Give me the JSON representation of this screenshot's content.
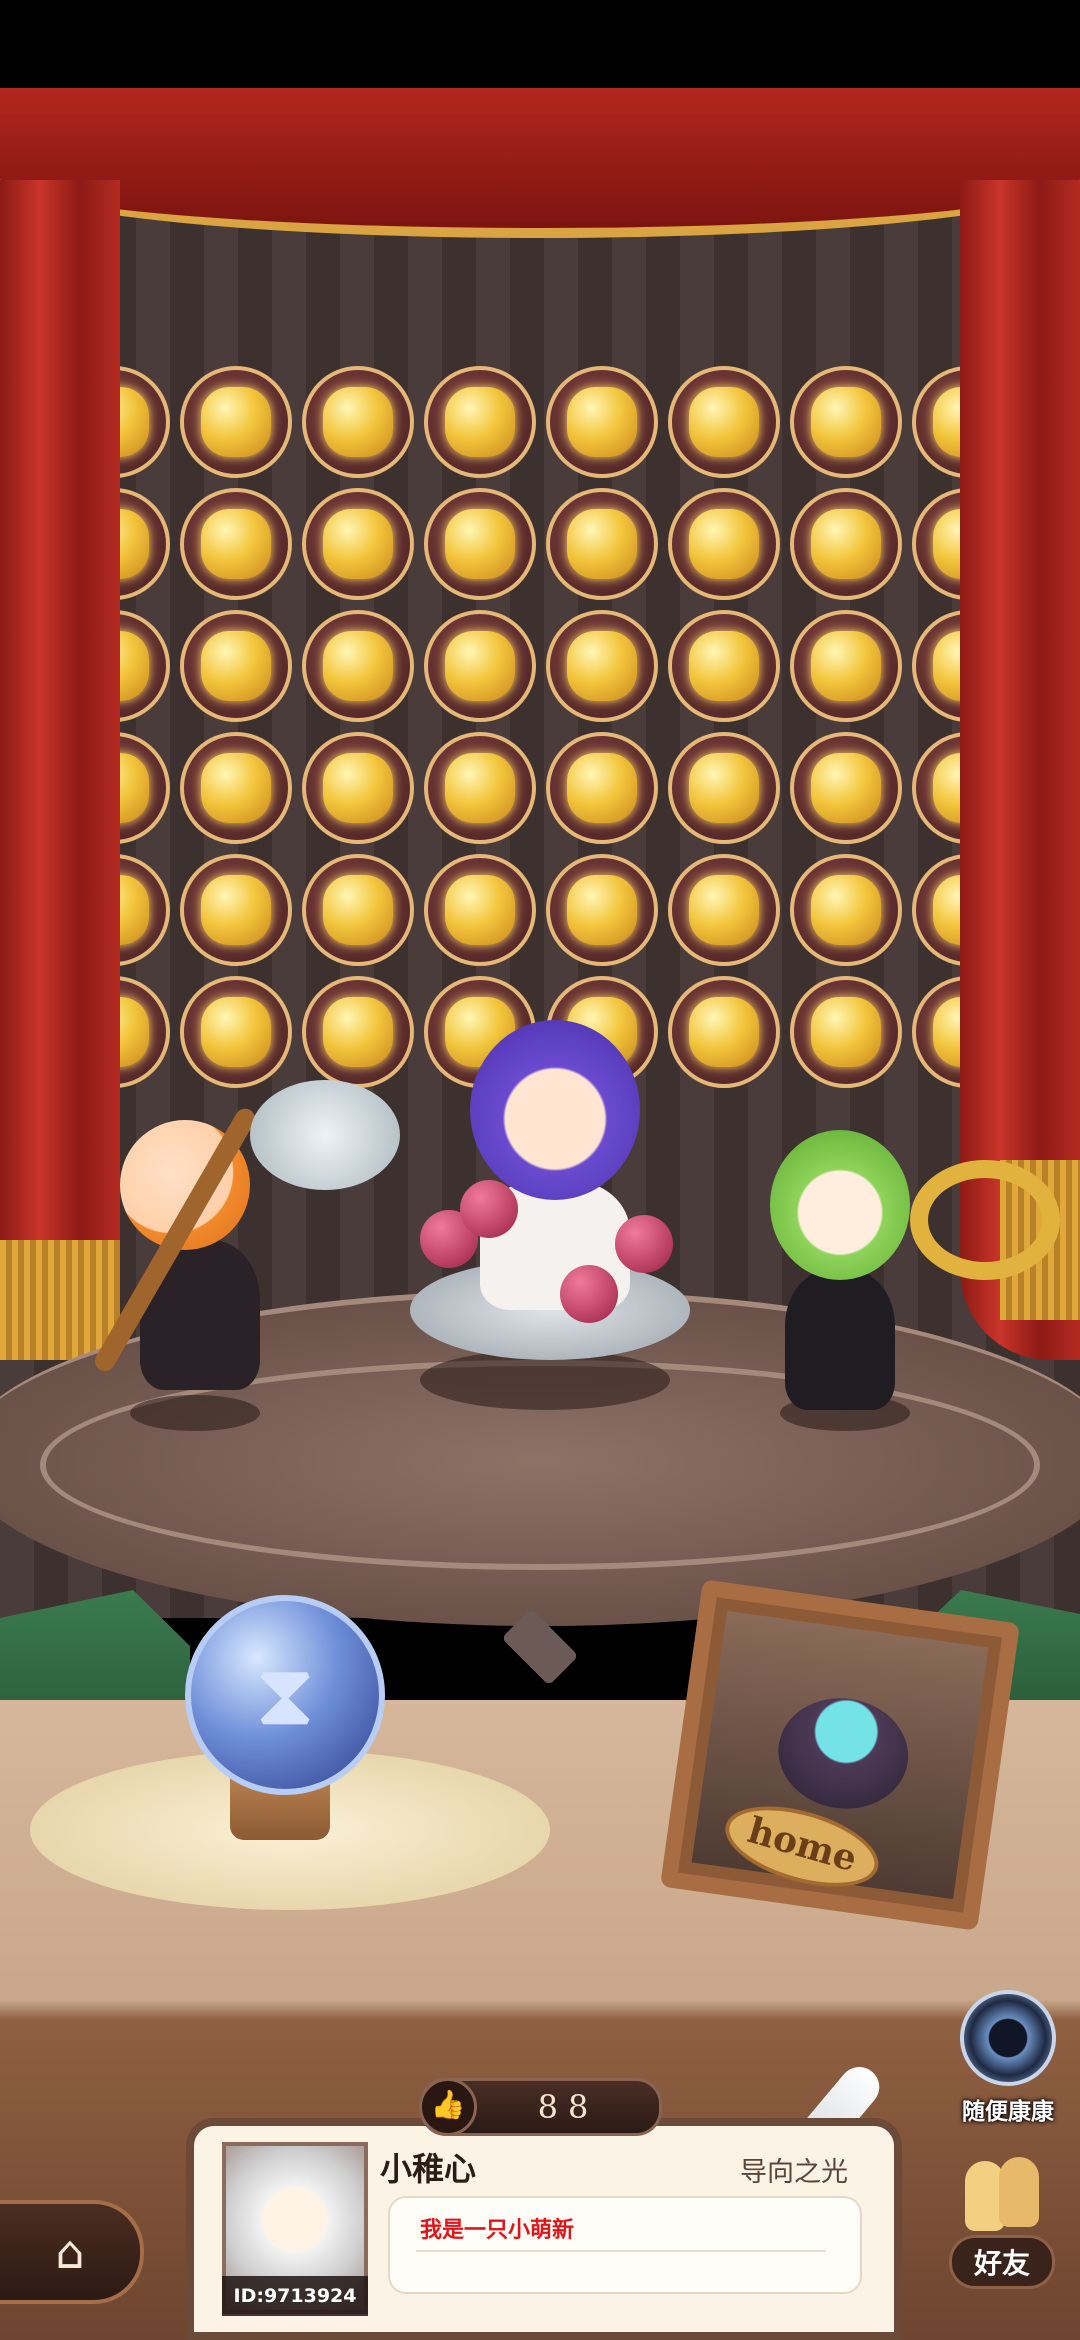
{
  "profile": {
    "username": "小稚心",
    "title": "导向之光",
    "user_id": "ID:9713924",
    "bio": "我是一只小萌新",
    "likes": "88"
  },
  "buttons": {
    "random_visit": "随便康康",
    "friends": "好友",
    "home_frame": "home"
  },
  "icons": {
    "timer": "hourglass-icon",
    "home": "house-icon",
    "like": "thumbs-up-icon",
    "random": "portal-icon",
    "friends": "friends-icon"
  },
  "colors": {
    "gold": "#f3c63d",
    "bio_text": "#e0151a",
    "curtain": "#b3261e"
  },
  "medals": {
    "rows": 6,
    "columns": 8,
    "count": 48
  }
}
